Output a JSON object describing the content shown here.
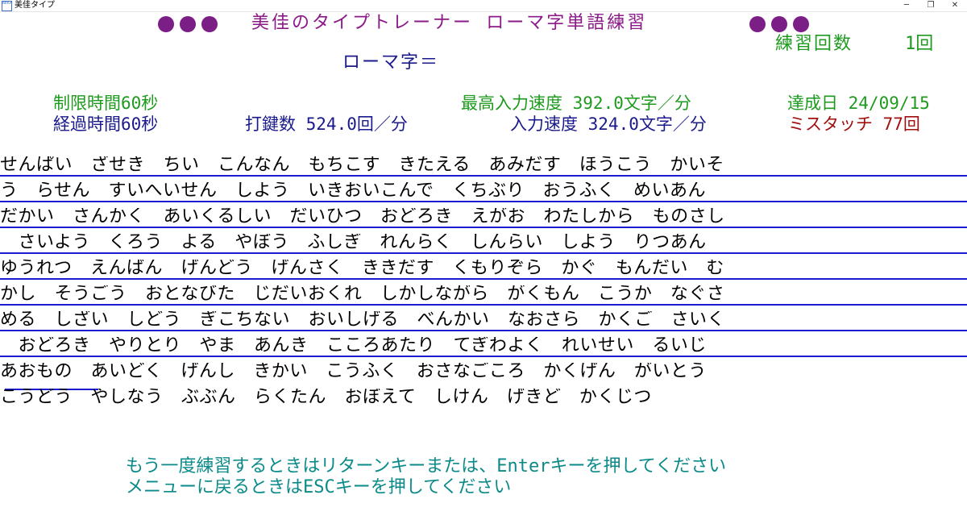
{
  "window": {
    "icon_text": "MIKA",
    "title": "美佳タイプ",
    "minimize_icon": "minimize-icon",
    "maximize_icon": "maximize-icon",
    "close_icon": "close-icon"
  },
  "header": {
    "title": "美佳のタイプトレーナー ローマ字単語練習",
    "practice_count_label": "練習回数",
    "practice_count_value": "1回"
  },
  "romaji_prompt": "ローマ字＝",
  "stats": {
    "time_limit": "制限時間60秒",
    "elapsed_time": "経過時間60秒",
    "keystrokes": "打鍵数 524.0回／分",
    "best_speed": "最高入力速度 392.0文字／分",
    "achieved_label": "達成日 24/09/15",
    "input_speed": "入力速度 324.0文字／分",
    "mistouch": "ミスタッチ 77回"
  },
  "word_rows": [
    "せんぱい　ざせき　ちい　こんなん　もちこす　きたえる　あみだす　ほうこう　かいそ",
    "う　らせん　すいへいせん　しよう　いきおいこんで　くちぶり　おうふく　めいあん",
    "だかい　さんかく　あいくるしい　だいひつ　おどろき　えがお　わたしから　ものさし",
    "　さいよう　くろう　よる　やぼう　ふしぎ　れんらく　しんらい　しよう　りつあん",
    "ゆうれつ　えんばん　げんどう　げんさく　ききだす　くもりぞら　かぐ　もんだい　む",
    "かし　そうごう　おとなびた　じだいおくれ　しかしながら　がくもん　こうか　なぐさ",
    "める　しざい　しどう　ぎこちない　おいしげる　べんかい　なおさら　かくご　さいく",
    "　おどろき　やりとり　やま　あんき　こころあたり　てぎわよく　れいせい　るいじ",
    "あおもの　あいどく　げんし　きかい　こうふく　おさなごころ　かくげん　がいとう",
    "こうどう　やしなう　ぶぶん　らくたん　おぼえて　しけん　げきど　かくじつ"
  ],
  "footer": {
    "retry_message": "もう一度練習するときはリターンキーまたは、Enterキーを押してください",
    "menu_message": "メニューに戻るときはESCキーを押してください"
  },
  "colors": {
    "purple": "#8b1a89",
    "green": "#1e9a1e",
    "navy": "#1a1a8c",
    "red": "#a01010",
    "teal": "#0b8a8a",
    "line": "#1a1ad0"
  }
}
